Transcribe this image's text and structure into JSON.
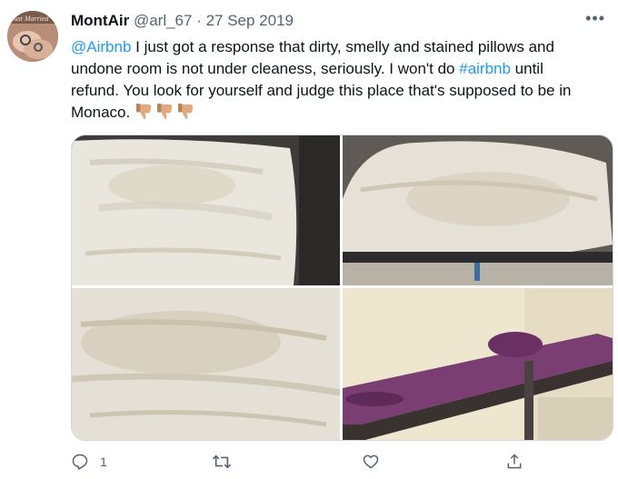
{
  "tweet": {
    "display_name": "MontAir",
    "handle": "@arl_67",
    "separator": " · ",
    "date": "27 Sep 2019",
    "more_label": "•••",
    "mention": "@Airbnb",
    "text_1": " I just got a response that dirty, smelly and stained pillows and undone room is not under cleaness, seriously. I won't do ",
    "hashtag": "#airbnb",
    "text_2": " until refund. You look for yourself and judge this place that's supposed to be in Monaco.",
    "emoji_names": [
      "thumbs-down-icon",
      "thumbs-down-icon",
      "thumbs-down-icon"
    ],
    "avatar_text": "Just Married"
  },
  "actions": {
    "reply_count": "1",
    "retweet_count": "",
    "like_count": ""
  },
  "colors": {
    "link": "#1d9bf0",
    "muted": "#536471",
    "border": "#cfd9de"
  }
}
